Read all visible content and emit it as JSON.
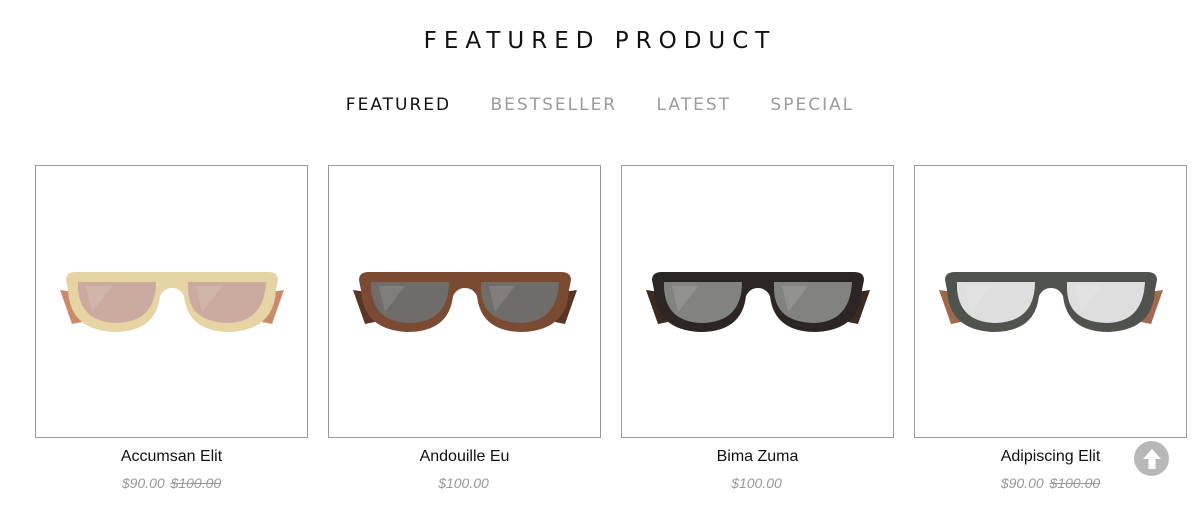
{
  "section": {
    "title": "FEATURED PRODUCT"
  },
  "tabs": [
    {
      "label": "FEATURED",
      "active": true
    },
    {
      "label": "BESTSELLER",
      "active": false
    },
    {
      "label": "LATEST",
      "active": false
    },
    {
      "label": "SPECIAL",
      "active": false
    }
  ],
  "products": [
    {
      "name": "Accumsan Elit",
      "price": "$90.00",
      "old_price": "$100.00",
      "frame_color": "#e6d4a4",
      "lens_color": "#c9a7a0",
      "temple_color": "#c98b6e"
    },
    {
      "name": "Andouille Eu",
      "price": "$100.00",
      "old_price": "",
      "frame_color": "#7a4a32",
      "lens_color": "#6f6f6f",
      "temple_color": "#5a3524"
    },
    {
      "name": "Bima Zuma",
      "price": "$100.00",
      "old_price": "",
      "frame_color": "#2b2623",
      "lens_color": "#8a8a8a",
      "temple_color": "#3a2a20"
    },
    {
      "name": "Adipiscing Elit",
      "price": "$90.00",
      "old_price": "$100.00",
      "frame_color": "#4f524d",
      "lens_color": "#eaeaea",
      "temple_color": "#a0684c"
    }
  ],
  "back_to_top": {
    "icon": "arrow-up-icon"
  }
}
